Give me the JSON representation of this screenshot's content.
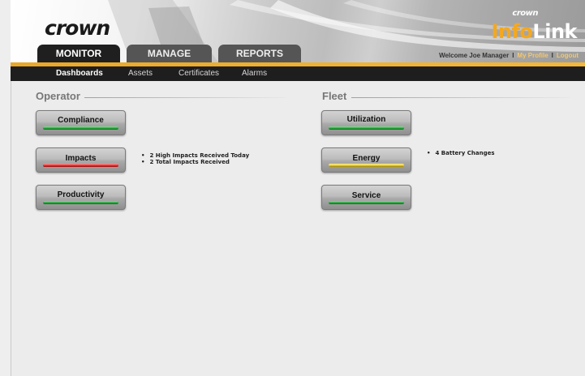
{
  "header": {
    "logo": "crown",
    "brand_small": "crown",
    "brand_info_prefix": "Inf",
    "brand_o": "o",
    "brand_link": "Link",
    "welcome": "Welcome Joe Manager",
    "my_profile": "My Profile",
    "logout": "Logout",
    "separator": "I"
  },
  "tabs": [
    {
      "label": "MONITOR",
      "active": true
    },
    {
      "label": "MANAGE",
      "active": false
    },
    {
      "label": "REPORTS",
      "active": false
    }
  ],
  "subnav": [
    {
      "label": "Dashboards",
      "active": true
    },
    {
      "label": "Assets",
      "active": false
    },
    {
      "label": "Certificates",
      "active": false
    },
    {
      "label": "Alarms",
      "active": false
    }
  ],
  "operator": {
    "title": "Operator",
    "buttons": [
      {
        "label": "Compliance",
        "status": "green"
      },
      {
        "label": "Impacts",
        "status": "red"
      },
      {
        "label": "Productivity",
        "status": "green"
      }
    ],
    "impacts_notes": [
      "2 High Impacts Received Today",
      "2 Total Impacts Received"
    ]
  },
  "fleet": {
    "title": "Fleet",
    "buttons": [
      {
        "label": "Utilization",
        "status": "green"
      },
      {
        "label": "Energy",
        "status": "yellow"
      },
      {
        "label": "Service",
        "status": "green"
      }
    ],
    "energy_notes": [
      "4 Battery Changes"
    ]
  },
  "colors": {
    "green": "#1fa035",
    "red": "#e02525",
    "yellow": "#e4c522",
    "accent": "#f4a820"
  }
}
